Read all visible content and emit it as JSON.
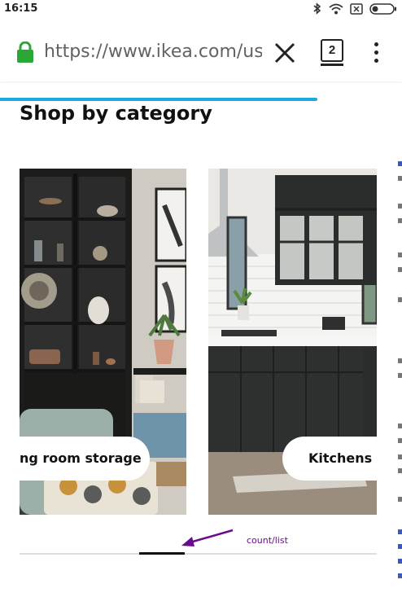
{
  "status_bar": {
    "time": "16:15",
    "icons": [
      "bluetooth-icon",
      "wifi-icon",
      "sim-icon",
      "battery-icon"
    ]
  },
  "browser": {
    "url": "https://www.ikea.com/us/e",
    "tab_count": "2",
    "load_progress_percent": 79,
    "accent_color": "#1ea8e0",
    "lock_color": "#2aa836"
  },
  "page": {
    "title": "Shop by category",
    "categories": [
      {
        "label": "ng room storage"
      },
      {
        "label": "Kitchens"
      }
    ],
    "carousel_scroll": {
      "thumb_start_fraction": 0.335,
      "thumb_fraction": 0.128
    }
  },
  "annotation": {
    "label": "count/list",
    "color": "#6a0c8c"
  }
}
